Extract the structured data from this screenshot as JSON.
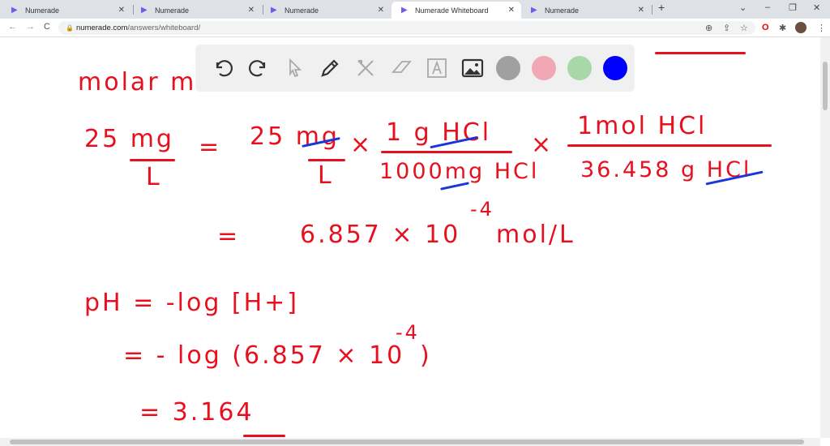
{
  "tabs": [
    {
      "label": "Numerade"
    },
    {
      "label": "Numerade"
    },
    {
      "label": "Numerade"
    },
    {
      "label": "Numerade Whiteboard",
      "active": true
    },
    {
      "label": "Numerade"
    }
  ],
  "address": {
    "domain": "numerade.com",
    "path": "/answers/whiteboard/"
  },
  "toolbar": {
    "tools": [
      "undo-icon",
      "redo-icon",
      "select-icon",
      "pen-icon",
      "tools-icon",
      "eraser-icon",
      "text-icon",
      "image-icon"
    ],
    "colors": [
      "#a0a0a0",
      "#f0a8b4",
      "#a8d8a8",
      "#0000ff"
    ]
  },
  "board": {
    "l0": "molar m",
    "l1a": "25 mg",
    "l1b": "L",
    "eq1": "=",
    "l1c": "25 mg",
    "l1d": "L",
    "times1": "×",
    "f1n": "1 g HCl",
    "f1d": "1000mg HCl",
    "times2": "×",
    "f2n": "1mol HCl",
    "f2d": "36.458 g HCl",
    "l2eq": "=",
    "l2": "6.857 × 10",
    "l2exp": "-4",
    "l2unit": "mol/L",
    "l3": "pH = -log [H+]",
    "l4": "= - log (6.857 × 10",
    "l4exp": "-4",
    "l4end": ")",
    "l5": "= 3.164"
  },
  "colors": {
    "ink": "#e8101e",
    "strike": "#1a35d8"
  }
}
